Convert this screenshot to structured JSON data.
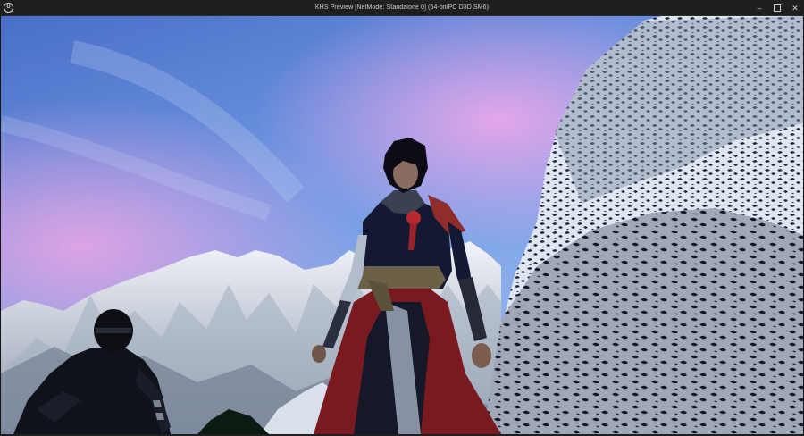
{
  "window": {
    "logo_text": "U",
    "title": "KHS Preview [NetMode: Standalone 0]  (64-bit/PC D3D SM6)",
    "controls": {
      "minimize": "–",
      "close": "✕"
    }
  },
  "icons": {
    "logo": "unreal-engine-logo-icon",
    "minimize": "minimize-icon",
    "maximize": "maximize-icon",
    "close": "close-icon"
  },
  "scene": {
    "colors": {
      "sky_top": "#4e73c9",
      "sky_mid": "#7fa6e8",
      "sky_pink": "#e7a6e6",
      "snow": "#e9eef7",
      "rock": "#1a2432",
      "cloth_red": "#8c1f25",
      "cloth_dark": "#141625"
    }
  }
}
